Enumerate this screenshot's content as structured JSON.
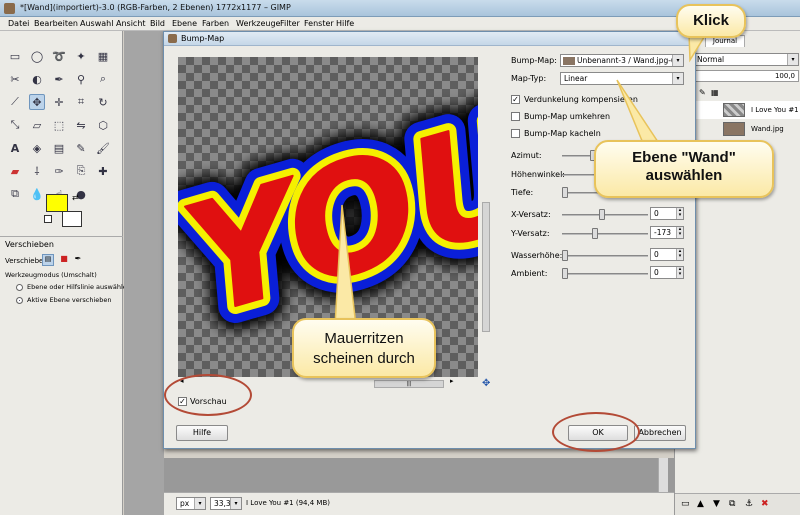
{
  "window": {
    "title": "*[Wand](importiert)-3.0 (RGB-Farben, 2 Ebenen) 1772x1177 – GIMP"
  },
  "menu": [
    "Datei",
    "Bearbeiten",
    "Auswahl",
    "Ansicht",
    "Bild",
    "Ebene",
    "Farben",
    "Werkzeuge",
    "Filter",
    "Fenster",
    "Hilfe"
  ],
  "toolbox": {
    "panel_title": "Verschieben",
    "move_label": "Verschieben:",
    "mode_label": "Werkzeugmodus (Umschalt)",
    "option_1": "Ebene oder Hilfslinie auswählen",
    "option_2": "Aktive Ebene verschieben",
    "colors": {
      "fg": "#ffff00",
      "bg": "#ffffff"
    }
  },
  "statusbar": {
    "unit": "px",
    "zoom": "33,3 %",
    "info": "I Love You #1 (94,4 MB)"
  },
  "layers": {
    "tab": "Journal",
    "mode": "Normal",
    "opacity": "100,0",
    "items": [
      {
        "name": "I Love You #1"
      },
      {
        "name": "Wand.jpg"
      }
    ]
  },
  "dialog": {
    "title": "Bump-Map",
    "bumpmap_label": "Bump-Map:",
    "bumpmap_value": "Unbenannt-3 / Wand.jpg-6",
    "maptype_label": "Map-Typ:",
    "maptype_value": "Linear",
    "check_1": "Verdunkelung kompensieren",
    "check_2": "Bump-Map umkehren",
    "check_3": "Bump-Map kacheln",
    "params": [
      {
        "label": "Azimut:"
      },
      {
        "label": "Höhenwinkel:"
      },
      {
        "label": "Tiefe:"
      },
      {
        "label": "X-Versatz:",
        "value": "0"
      },
      {
        "label": "Y-Versatz:",
        "value": "-173"
      },
      {
        "label": "Wasserhöhe:",
        "value": "0"
      },
      {
        "label": "Ambient:",
        "value": "0"
      }
    ],
    "preview_label": "Vorschau",
    "help_button": "Hilfe",
    "ok_button": "OK",
    "cancel_button": "Abbrechen"
  },
  "callouts": {
    "klick": "Klick",
    "ebene_line1": "Ebene \"Wand\"",
    "ebene_line2": "auswählen",
    "mauer_line1": "Mauerritzen",
    "mauer_line2": "scheinen durch"
  },
  "preview_text": "YOU",
  "accent_colors": {
    "callout_border": "#e8c35b",
    "ring": "#b34a36",
    "text_red": "#e01010",
    "text_blue": "#0a1fd8",
    "text_yellow": "#f5f000"
  }
}
